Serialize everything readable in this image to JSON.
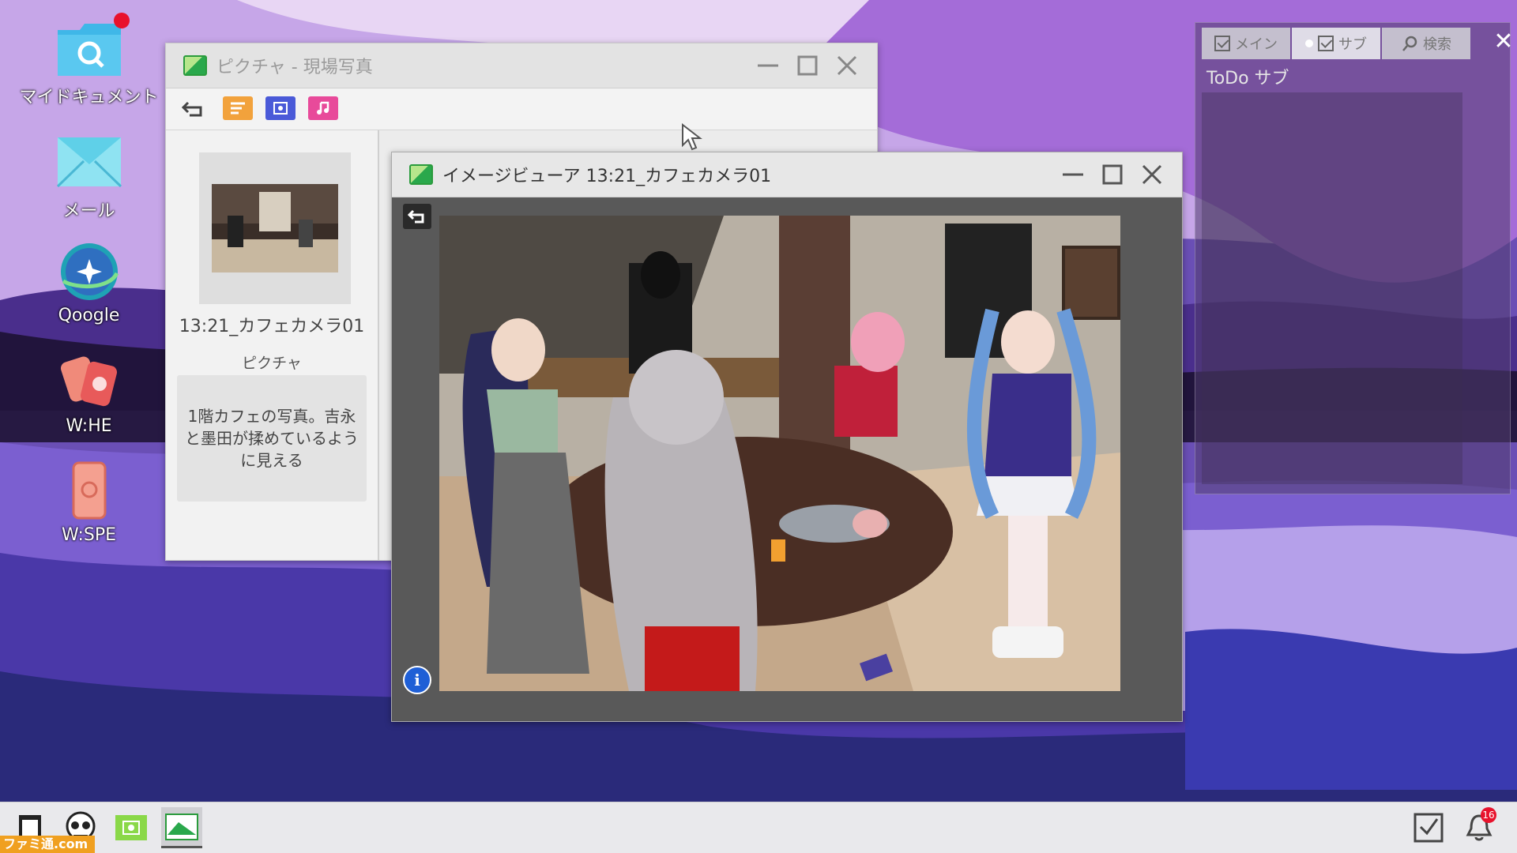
{
  "desktop": {
    "icons": [
      {
        "label": "マイドキュメント",
        "icon": "document-search-icon"
      },
      {
        "label": "メール",
        "icon": "mail-icon"
      },
      {
        "label": "Qoogle",
        "icon": "browser-globe-icon"
      },
      {
        "label": "W:HE",
        "icon": "whe-app-icon"
      },
      {
        "label": "W:SPE",
        "icon": "wspe-phone-icon"
      }
    ]
  },
  "explorer": {
    "title": "ピクチャ - 現場写真",
    "toolbar": [
      "back-icon",
      "document-folder-icon",
      "picture-folder-icon",
      "music-folder-icon"
    ],
    "selected_file": {
      "name": "13:21_カフェカメラ01",
      "type": "ピクチャ",
      "description": "1階カフェの写真。吉永と墨田が揉めているように見える"
    }
  },
  "viewer": {
    "title": "イメージビューア 13:21_カフェカメラ01"
  },
  "todo": {
    "tabs": [
      {
        "label": "メイン",
        "icon": "checkbox-icon"
      },
      {
        "label": "サブ",
        "icon": "checkbox-icon",
        "active": true
      },
      {
        "label": "検索",
        "icon": "search-icon"
      }
    ],
    "title": "ToDo サブ"
  },
  "taskbar": {
    "apps": [
      "document-icon",
      "skull-face-icon",
      "pictures-app-icon",
      "image-viewer-icon"
    ],
    "notification_count": "16",
    "watermark": "ファミ通.com"
  },
  "colors": {
    "accent_blue": "#1f5fd6",
    "badge_red": "#e8122c",
    "viewer_bg": "#595959"
  }
}
